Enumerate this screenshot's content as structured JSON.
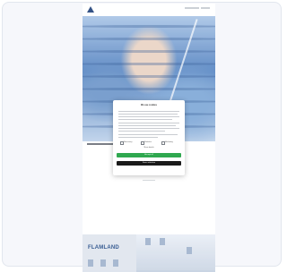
{
  "cookie_banner": {
    "title": "We use cookies",
    "options": [
      {
        "label": "Necessary",
        "checked": true
      },
      {
        "label": "Statistics",
        "checked": false
      },
      {
        "label": "Marketing",
        "checked": false
      }
    ],
    "details_link": "Show details",
    "accept_all_label": "Accept all",
    "save_label": "Save selection"
  },
  "bottom_image": {
    "sign_text": "FLAMLAND"
  },
  "colors": {
    "accept_button": "#2fa84f",
    "save_button": "#1a1a1a",
    "logo": "#1d3f78"
  }
}
